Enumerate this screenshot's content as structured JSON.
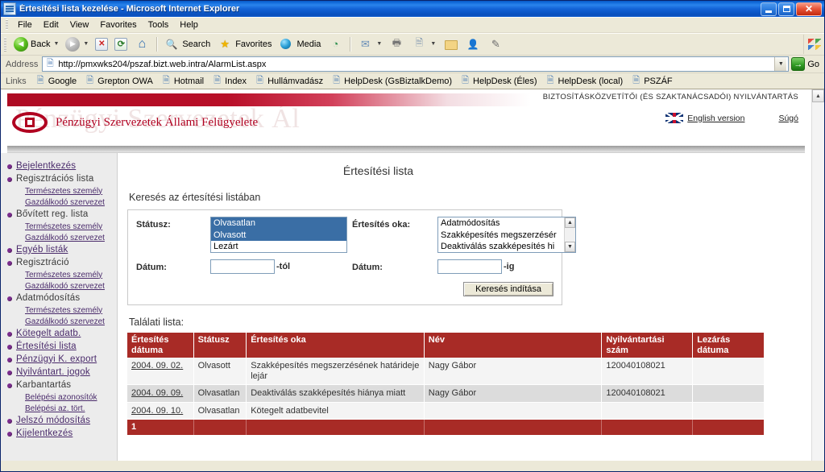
{
  "window": {
    "title": "Értesítési lista kezelése - Microsoft Internet Explorer",
    "minimize_label": "Minimize",
    "maximize_label": "Maximize",
    "close_label": "Close"
  },
  "menu": {
    "items": [
      "File",
      "Edit",
      "View",
      "Favorites",
      "Tools",
      "Help"
    ]
  },
  "toolbar": {
    "back_label": "Back",
    "search_label": "Search",
    "favorites_label": "Favorites",
    "media_label": "Media"
  },
  "address": {
    "label": "Address",
    "url": "http://pmxwks204/pszaf.bizt.web.intra/AlarmList.aspx",
    "go_label": "Go"
  },
  "links": {
    "label": "Links",
    "items": [
      "Google",
      "Grepton OWA",
      "Hotmail",
      "Index",
      "Hullámvadász",
      "HelpDesk (GsBiztalkDemo)",
      "HelpDesk (Éles)",
      "HelpDesk (local)",
      "PSZÁF"
    ]
  },
  "banner": {
    "watermark": "Pénzügyi Szervezetek Ál",
    "logo_text": "Pénzügyi Szervezetek Állami Felügyelete",
    "caption": "BIZTOSÍTÁSKÖZVETÍTŐI (ÉS SZAKTANÁCSADÓI) NYILVÁNTARTÁS",
    "english_link": "English version",
    "help_link": "Súgó",
    "brand_color": "#b00020"
  },
  "sidebar": {
    "items": [
      {
        "label": "Bejelentkezés",
        "type": "main",
        "link": true
      },
      {
        "label": "Regisztrációs lista",
        "type": "main",
        "link": false
      },
      {
        "label": "Természetes személy",
        "type": "sub"
      },
      {
        "label": "Gazdálkodó szervezet",
        "type": "sub"
      },
      {
        "label": "Bővített reg. lista",
        "type": "main",
        "link": false
      },
      {
        "label": "Természetes személy",
        "type": "sub"
      },
      {
        "label": "Gazdálkodó szervezet",
        "type": "sub"
      },
      {
        "label": "Egyéb listák",
        "type": "main",
        "link": true
      },
      {
        "label": "Regisztráció",
        "type": "main",
        "link": false
      },
      {
        "label": "Természetes személy",
        "type": "sub"
      },
      {
        "label": "Gazdálkodó szervezet",
        "type": "sub"
      },
      {
        "label": "Adatmódosítás",
        "type": "main",
        "link": false
      },
      {
        "label": "Természetes személy",
        "type": "sub"
      },
      {
        "label": "Gazdálkodó szervezet",
        "type": "sub"
      },
      {
        "label": "Kötegelt adatb.",
        "type": "main",
        "link": true
      },
      {
        "label": "Értesítési lista",
        "type": "main",
        "link": true
      },
      {
        "label": "Pénzügyi K. export",
        "type": "main",
        "link": true
      },
      {
        "label": "Nyilvántart. jogok",
        "type": "main",
        "link": true
      },
      {
        "label": "Karbantartás",
        "type": "main",
        "link": false
      },
      {
        "label": "Belépési azonosítók",
        "type": "sub"
      },
      {
        "label": "Belépési az. tört.",
        "type": "sub"
      },
      {
        "label": "Jelszó módosítás",
        "type": "main",
        "link": true
      },
      {
        "label": "Kijelentkezés",
        "type": "main",
        "link": true
      }
    ]
  },
  "main": {
    "page_title": "Értesítési lista",
    "search_heading": "Keresés az értesítési listában",
    "form": {
      "status_label": "Státusz:",
      "status_options": [
        "Olvasatlan",
        "Olvasott",
        "Lezárt"
      ],
      "status_selected": [
        "Olvasatlan",
        "Olvasott"
      ],
      "reason_label": "Értesítés oka:",
      "reason_options": [
        "Adatmódosítás",
        "Szakképesítés megszerzésér",
        "Deaktiválás szakképesítés hi"
      ],
      "date_from_label": "Dátum:",
      "date_from_value": "",
      "date_from_suffix": "-tól",
      "date_to_label": "Dátum:",
      "date_to_value": "",
      "date_to_suffix": "-ig",
      "submit_label": "Keresés indítása"
    },
    "results_label": "Találati lista:",
    "table": {
      "columns": [
        "Értesítés dátuma",
        "Státusz",
        "Értesítés oka",
        "Név",
        "Nyilvántartási szám",
        "Lezárás dátuma"
      ],
      "rows": [
        {
          "date": "2004. 09. 02.",
          "status": "Olvasott",
          "reason": "Szakképesítés megszerzésének határideje lejár",
          "name": "Nagy Gábor",
          "reg_number": "120040108021",
          "closed_date": ""
        },
        {
          "date": "2004. 09. 09.",
          "status": "Olvasatlan",
          "reason": "Deaktiválás szakképesítés hiánya miatt",
          "name": "Nagy Gábor",
          "reg_number": "120040108021",
          "closed_date": ""
        },
        {
          "date": "2004. 09. 10.",
          "status": "Olvasatlan",
          "reason": "Kötegelt adatbevitel",
          "name": "",
          "reg_number": "",
          "closed_date": ""
        }
      ],
      "pager": [
        "1"
      ],
      "header_color": "#a82b26"
    }
  }
}
